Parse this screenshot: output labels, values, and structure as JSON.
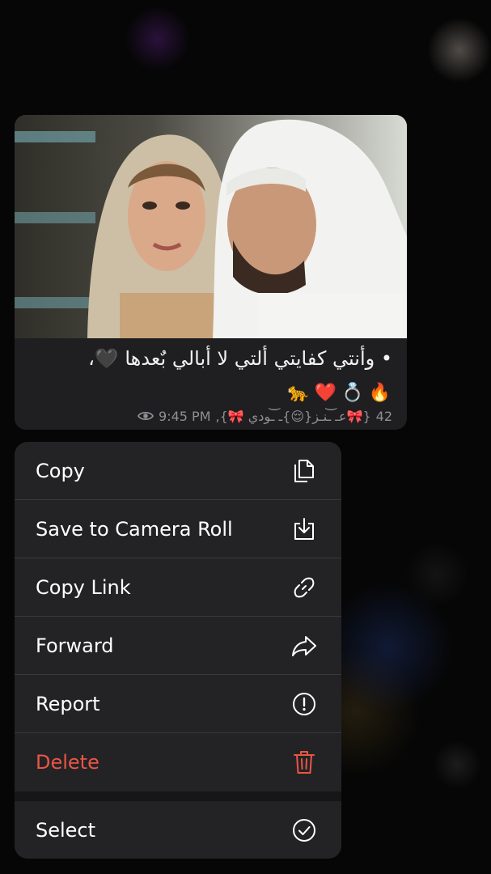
{
  "message": {
    "caption": "• وأنتي كفايتي ألتي لا أبالي بٌعدها 🖤،",
    "emojis": [
      "🔥",
      "💍",
      "❤️",
      "🐆"
    ],
    "reactions_count": "42",
    "sender_signature": "{🎀عـ ͝͝ـنـز{😌}ـ ͝͝ـودي 🎀},",
    "time": "9:45 PM",
    "views_icon": "eye-icon",
    "bow_color": "#ff6ea9"
  },
  "menu": {
    "items": [
      {
        "label": "Copy",
        "icon": "copy-icon"
      },
      {
        "label": "Save to Camera Roll",
        "icon": "save-download-icon"
      },
      {
        "label": "Copy Link",
        "icon": "link-icon"
      },
      {
        "label": "Forward",
        "icon": "forward-arrow-icon"
      },
      {
        "label": "Report",
        "icon": "exclamation-circle-icon"
      },
      {
        "label": "Delete",
        "icon": "trash-icon",
        "color": "#eb5545"
      },
      {
        "label": "Select",
        "icon": "checkmark-circle-icon"
      }
    ]
  },
  "colors": {
    "menu_background": "#232326",
    "text": "#ffffff",
    "destructive": "#eb5545"
  }
}
